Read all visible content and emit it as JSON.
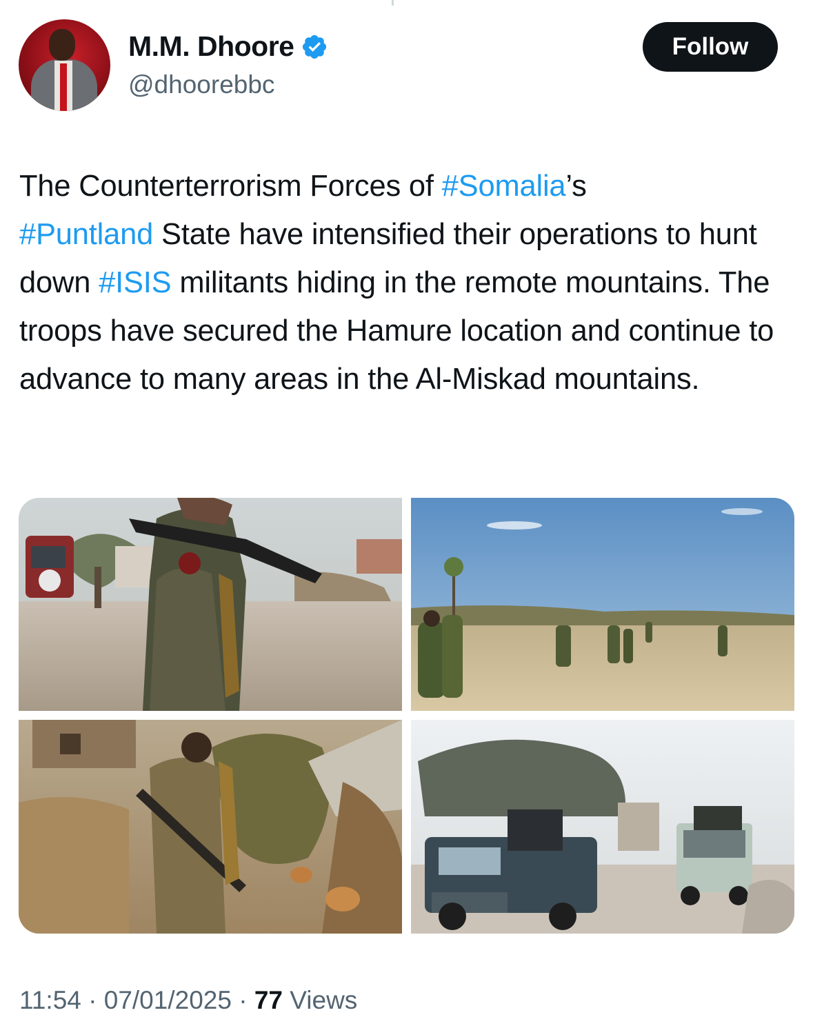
{
  "author": {
    "display_name": "M.M. Dhoore",
    "handle": "@dhoorebbc",
    "verified": true,
    "avatar_icon": "profile-photo",
    "verified_icon": "verified-badge-icon"
  },
  "actions": {
    "follow_label": "Follow"
  },
  "tweet": {
    "text_segments": {
      "s1": "The Counterterrorism Forces of ",
      "h1": "#Somalia",
      "s2": "’s",
      "h2": "#Puntland",
      "s3": " State have intensified their operations to hunt down ",
      "h3": "#ISIS",
      "s4": " militants hiding in the remote mountains. The troops have secured the Hamure location and continue to advance to many areas in the Al-Miskad mountains."
    },
    "media_count": 4
  },
  "meta": {
    "time": "11:54",
    "sep1": " · ",
    "date": "07/01/2025",
    "sep2": " · ",
    "views_count": "77",
    "views_label": " Views"
  },
  "colors": {
    "text": "#0f1419",
    "secondary": "#536471",
    "link": "#1d9bf0",
    "button_bg": "#0f1419",
    "button_text": "#ffffff"
  }
}
